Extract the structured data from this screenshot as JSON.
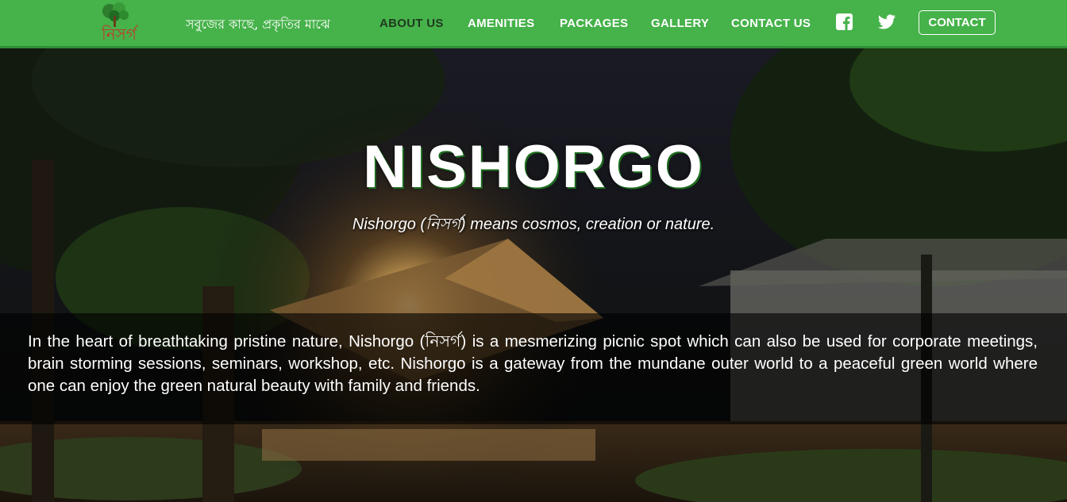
{
  "header": {
    "tagline": "সবুজের কাছে, প্রকৃতির মাঝে",
    "nav": [
      {
        "label": "ABOUT US",
        "active": true
      },
      {
        "label": "AMENITIES"
      },
      {
        "label": "PACKAGES"
      },
      {
        "label": "GALLERY"
      },
      {
        "label": "CONTACT US"
      }
    ],
    "social": [
      "facebook-icon",
      "twitter-icon"
    ],
    "contact_button": "CONTACT"
  },
  "hero": {
    "title": "NISHORGO",
    "subtitle": "Nishorgo (নিসর্গ) means cosmos, creation or nature.",
    "about": "In the heart of breathtaking pristine nature, Nishorgo (নিসর্গ) is a mesmerizing picnic spot which can also be  used for corporate meetings, brain storming sessions, seminars, workshop, etc. Nishorgo is a gateway from the mundane outer world to a peaceful green world where one can enjoy the green natural beauty with family and friends."
  },
  "colors": {
    "nav_bg": "#46b24a",
    "nav_active": "#1f3a1f",
    "overlay": "rgba(0,0,0,0.62)"
  }
}
